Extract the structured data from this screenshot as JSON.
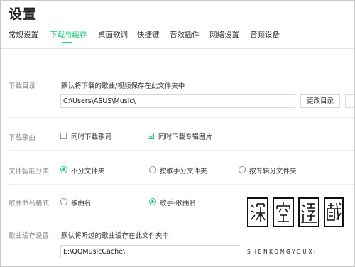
{
  "window": {
    "title": "设置"
  },
  "tabs": [
    {
      "label": "常规设置"
    },
    {
      "label": "下载与缓存",
      "active": true
    },
    {
      "label": "桌面歌词"
    },
    {
      "label": "快捷键"
    },
    {
      "label": "音效插件"
    },
    {
      "label": "网络设置"
    },
    {
      "label": "音频设备"
    }
  ],
  "download_dir": {
    "label": "下载目录",
    "description": "默认将下载的歌曲/视频保存在此文件夹中",
    "path": "C:\\Users\\ASUS\\Music\\",
    "change_button": "更改目录"
  },
  "download_song": {
    "label": "下载歌曲",
    "options": [
      {
        "label": "同时下载歌词",
        "checked": false
      },
      {
        "label": "同时下载专辑图片",
        "checked": true
      }
    ]
  },
  "smart_classify": {
    "label": "文件智能分类",
    "options": [
      {
        "label": "不分文件夹",
        "selected": true
      },
      {
        "label": "按歌手分文件夹",
        "selected": false
      },
      {
        "label": "按专辑分文件夹",
        "selected": false
      }
    ]
  },
  "naming_format": {
    "label": "歌曲命名格式",
    "options": [
      {
        "label": "歌曲名",
        "selected": false
      },
      {
        "label": "歌手-歌曲名",
        "selected": true
      }
    ]
  },
  "cache": {
    "label": "歌曲缓存设置",
    "description": "默认将听过的歌曲缓存在此文件夹中",
    "path": "E:\\QQMusicCache\\"
  },
  "watermark": {
    "characters": [
      "深",
      "空",
      "遊",
      "戲"
    ],
    "letters": "SHENKONGYOUXI"
  },
  "colors": {
    "accent": "#23c77b"
  }
}
